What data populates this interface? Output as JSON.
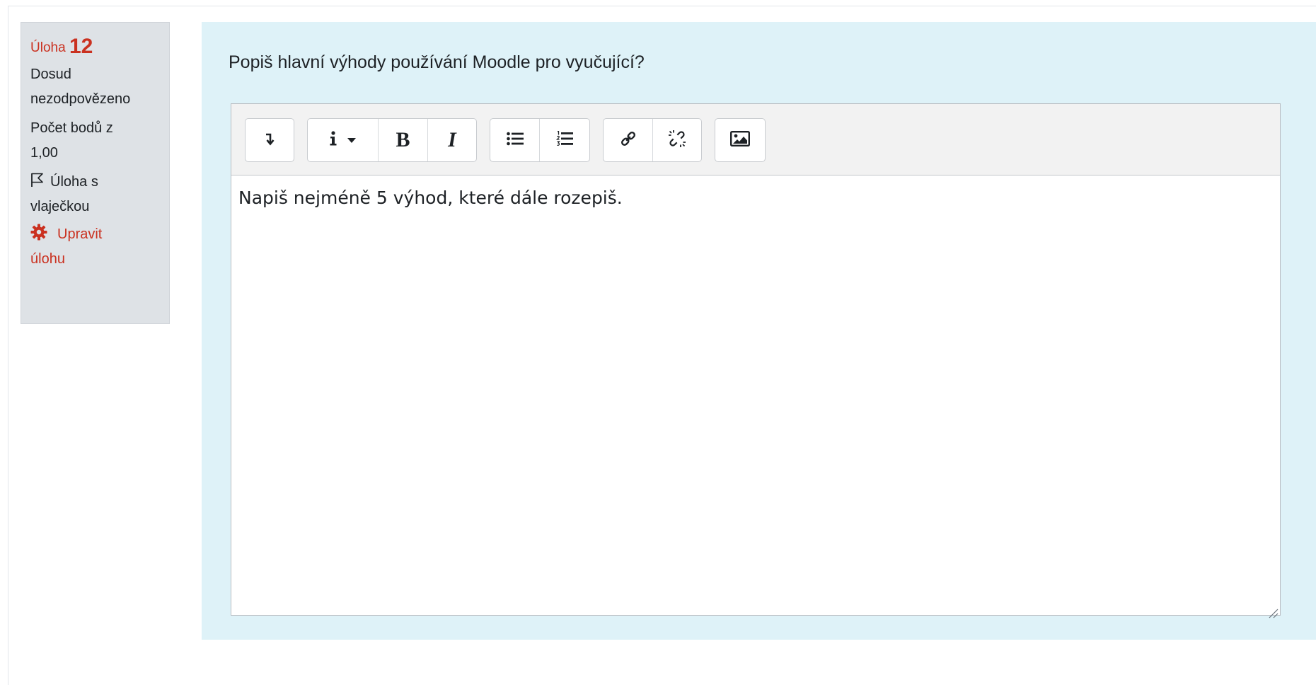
{
  "question": {
    "label": "Úloha",
    "number": "12",
    "status_line1": "Dosud",
    "status_line2": "nezodpovězeno",
    "points_line1": "Počet bodů z",
    "points_line2": "1,00",
    "flag_line1": "Úloha s",
    "flag_line2": "vlaječkou",
    "edit_line1": "Upravit",
    "edit_line2": "úlohu",
    "text": "Popiš hlavní výhody používání Moodle pro vyučující?"
  },
  "editor": {
    "content": "Napiš nejméně 5 výhod, které dále rozepiš.",
    "toolbar": {
      "expand_icon": "expand-toolbar-icon",
      "groups": [
        [
          "expand-toolbar"
        ],
        [
          "paragraph-styles",
          "bold",
          "italic"
        ],
        [
          "unordered-list",
          "ordered-list"
        ],
        [
          "link",
          "unlink"
        ],
        [
          "image"
        ]
      ],
      "bold_label": "B",
      "italic_label": "I"
    }
  },
  "colors": {
    "accent_red": "#ca3120",
    "content_bg": "#def2f8",
    "info_bg": "#dee2e6"
  }
}
